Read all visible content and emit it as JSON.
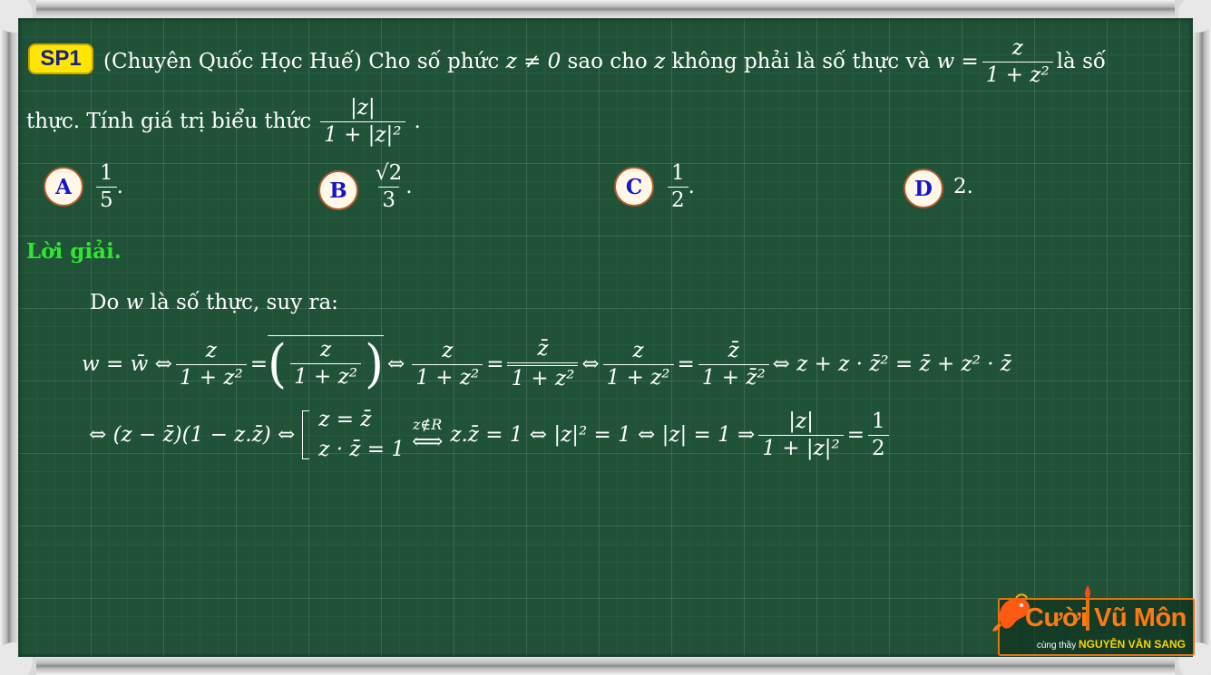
{
  "problem": {
    "badge": "SP1",
    "source": "(Chuyên Quốc Học Huế)",
    "text_1": "Cho số phức",
    "cond": "z ≠ 0",
    "text_2": "sao cho",
    "z": "z",
    "text_3": "không phải là số thực và",
    "w_eq": "w =",
    "w_num": "z",
    "w_den": "1 + z²",
    "text_4": "là số",
    "text_5": "thực. Tính giá trị biểu thức",
    "expr_num": "|z|",
    "expr_den": "1 + |z|²",
    "period": "."
  },
  "options": [
    {
      "letter": "A",
      "num": "1",
      "den": "5",
      "tail": "."
    },
    {
      "letter": "B",
      "num": "√2",
      "den": "3",
      "tail": "."
    },
    {
      "letter": "C",
      "num": "1",
      "den": "2",
      "tail": "."
    },
    {
      "letter": "D",
      "value": "2."
    }
  ],
  "solution": {
    "label": "Lời giải.",
    "intro_1": "Do",
    "intro_w": "w",
    "intro_2": "là số thực, suy ra:",
    "line1": {
      "lhs": "w = w̄ ⇔",
      "f1_num": "z",
      "f1_den": "1 + z²",
      "eq": "=",
      "f2_num": "z",
      "f2_den": "1 + z²",
      "iff": "⇔",
      "f3_num": "z",
      "f3_den": "1 + z²",
      "eq2": "=",
      "f4_num": "z̄",
      "f4_den": "1 + z²",
      "iff2": "⇔",
      "f5_num": "z",
      "f5_den": "1 + z²",
      "eq3": "=",
      "f6_num": "z̄",
      "f6_den": "1 + z̄²",
      "tail": "⇔ z + z · z̄² = z̄ + z² · z̄"
    },
    "line2": {
      "start": "⇔ (z − z̄)(1 − z.z̄) ⇔",
      "case1": "z = z̄",
      "case2": "z · z̄ = 1",
      "arrow_label": "z∉R",
      "arrow": "⟺",
      "after": "z.z̄ = 1 ⇔ |z|² = 1 ⇔ |z| = 1 ⇒",
      "f_num": "|z|",
      "f_den": "1 + |z|²",
      "eq": "=",
      "r_num": "1",
      "r_den": "2"
    }
  },
  "logo": {
    "title": "Cười Vũ Môn",
    "sub_prefix": "cùng thầy",
    "sub_name": "NGUYỄN VĂN SANG"
  }
}
